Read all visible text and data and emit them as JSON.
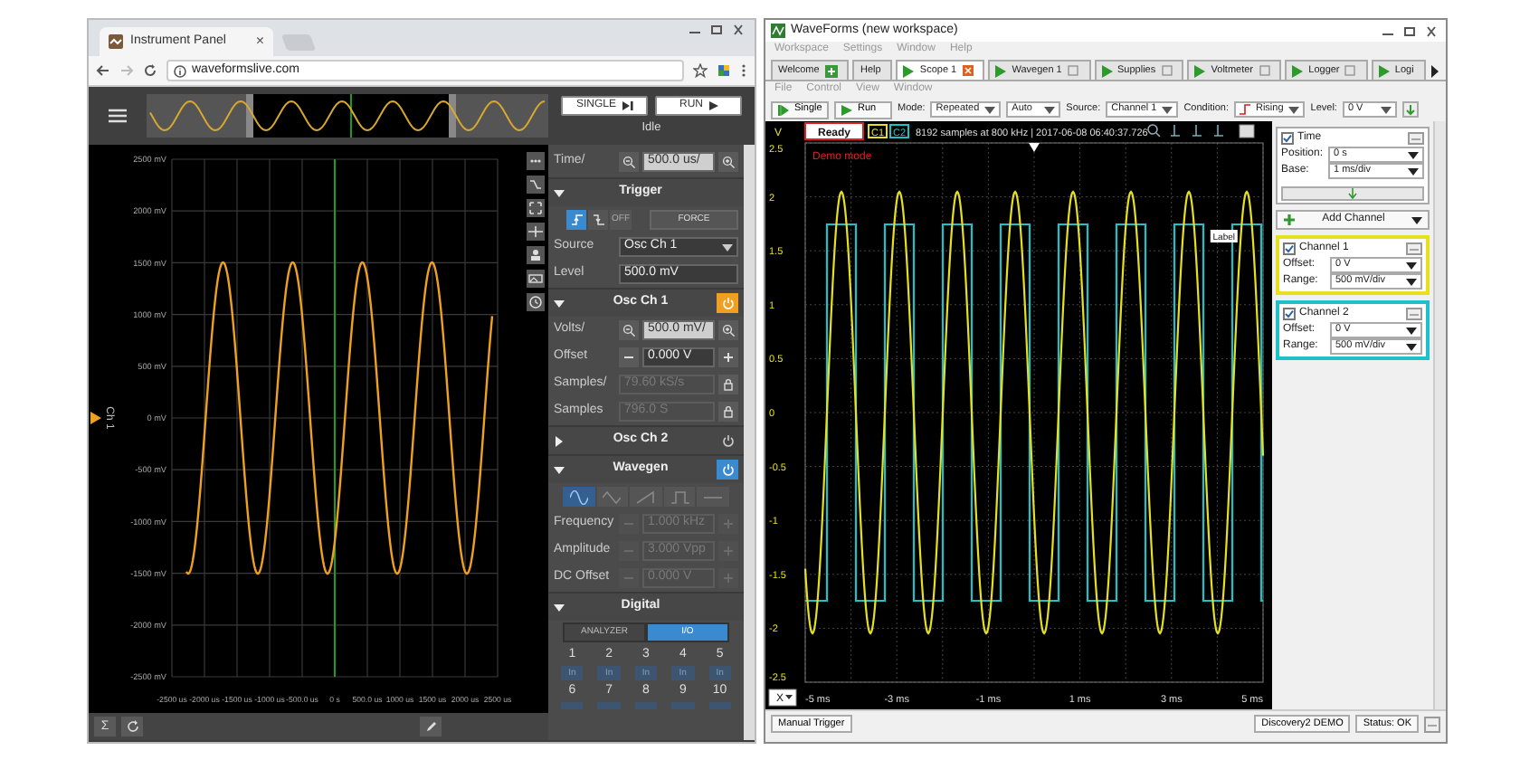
{
  "left_window": {
    "tab": {
      "title": "Instrument Panel",
      "close": "×"
    },
    "address": "waveformslive.com",
    "run_buttons": [
      {
        "label": "SINGLE",
        "kind": "single"
      },
      {
        "label": "RUN",
        "kind": "run"
      }
    ],
    "run_status": "Idle",
    "plot": {
      "channel_label": "Ch 1",
      "y_labels": [
        "2500 mV",
        "2000 mV",
        "1500 mV",
        "1000 mV",
        "500 mV",
        "0 mV",
        "-500 mV",
        "-1000 mV",
        "-1500 mV",
        "-2000 mV",
        "-2500 mV"
      ],
      "x_labels": [
        "-2500 us",
        "-2000 us",
        "-1500 us",
        "-1000 us",
        "-500.0 us",
        "0 s",
        "500.0 us",
        "1000 us",
        "1500 us",
        "2000 us",
        "2500 us"
      ]
    },
    "bottom_tools": [
      {
        "kind": "sigma",
        "glyph": "Σ"
      },
      {
        "kind": "refresh"
      },
      {
        "kind": "pencil"
      }
    ],
    "panel": {
      "time": {
        "label": "Time/",
        "value": "500.0 us/"
      },
      "sections": [
        {
          "kind": "trigger",
          "title": "Trigger",
          "expanded": true,
          "edges": [
            {
              "kind": "rising",
              "selected": true
            },
            {
              "kind": "falling",
              "selected": false
            },
            {
              "kind": "off",
              "label": "OFF",
              "selected": false
            }
          ],
          "force": "FORCE",
          "rows": [
            {
              "kind": "select",
              "label": "Source",
              "value": "Osc Ch 1",
              "disabled": false
            },
            {
              "kind": "input",
              "label": "Level",
              "value": "500.0 mV",
              "disabled": false
            }
          ]
        },
        {
          "kind": "osc",
          "title": "Osc Ch 1",
          "expanded": true,
          "on": true,
          "color": "#f0a020",
          "rows": [
            {
              "kind": "zoom",
              "label": "Volts/",
              "value": "500.0 mV/",
              "disabled": false
            },
            {
              "kind": "stepper",
              "label": "Offset",
              "value": "0.000 V",
              "disabled": false
            },
            {
              "kind": "locked",
              "label": "Samples/",
              "value": "79.60 kS/s",
              "disabled": true
            },
            {
              "kind": "locked",
              "label": "Samples",
              "value": "796.0 S",
              "disabled": true
            }
          ]
        },
        {
          "kind": "osc",
          "title": "Osc Ch 2",
          "expanded": false,
          "on": false
        },
        {
          "kind": "wavegen",
          "title": "Wavegen",
          "expanded": true,
          "on": true,
          "color": "#3a8ad0",
          "shapes": [
            {
              "kind": "sine",
              "selected": true
            },
            {
              "kind": "triangle",
              "selected": false
            },
            {
              "kind": "sawtooth",
              "selected": false
            },
            {
              "kind": "square",
              "selected": false
            },
            {
              "kind": "dc",
              "selected": false
            }
          ],
          "rows": [
            {
              "kind": "stepper",
              "label": "Frequency",
              "value": "1.000 kHz",
              "disabled": true
            },
            {
              "kind": "stepper",
              "label": "Amplitude",
              "value": "3.000 Vpp",
              "disabled": true
            },
            {
              "kind": "stepper",
              "label": "DC Offset",
              "value": "0.000 V",
              "disabled": true
            }
          ]
        },
        {
          "kind": "digital",
          "title": "Digital",
          "expanded": true,
          "modes": [
            {
              "label": "ANALYZER",
              "selected": false
            },
            {
              "label": "I/O",
              "selected": true
            }
          ],
          "pins": [
            {
              "number": "1",
              "state": "In"
            },
            {
              "number": "2",
              "state": "In"
            },
            {
              "number": "3",
              "state": "In"
            },
            {
              "number": "4",
              "state": "In"
            },
            {
              "number": "5",
              "state": "In"
            },
            {
              "number": "6"
            },
            {
              "number": "7"
            },
            {
              "number": "8"
            },
            {
              "number": "9"
            },
            {
              "number": "10"
            }
          ]
        }
      ]
    }
  },
  "right_window": {
    "title": "WaveForms (new workspace)",
    "menu": [
      "Workspace",
      "Settings",
      "Window",
      "Help"
    ],
    "tabs": [
      {
        "kind": "welcome",
        "label": "Welcome",
        "selected": false
      },
      {
        "kind": "plain",
        "label": "Help",
        "selected": false
      },
      {
        "kind": "instrument",
        "label": "Scope 1",
        "selected": true
      },
      {
        "kind": "instrument",
        "label": "Wavegen 1",
        "selected": false
      },
      {
        "kind": "instrument",
        "label": "Supplies",
        "selected": false
      },
      {
        "kind": "instrument",
        "label": "Voltmeter",
        "selected": false
      },
      {
        "kind": "instrument",
        "label": "Logger",
        "selected": false
      },
      {
        "kind": "cut",
        "label": "Logi",
        "selected": false
      }
    ],
    "submenu": [
      "File",
      "Control",
      "View",
      "Window"
    ],
    "toolbar": {
      "buttons": [
        {
          "kind": "single",
          "label": "Single"
        },
        {
          "kind": "run",
          "label": "Run"
        }
      ],
      "fields": [
        {
          "label": "Mode:",
          "selects": [
            {
              "value": "Repeated"
            },
            {
              "value": "Auto"
            }
          ]
        },
        {
          "label": "Source:",
          "selects": [
            {
              "value": "Channel 1"
            }
          ]
        },
        {
          "label": "Condition:",
          "selects": [
            {
              "value": "Rising",
              "kind": "edge"
            }
          ]
        },
        {
          "label": "Level:",
          "selects": [
            {
              "value": "0 V"
            }
          ]
        }
      ]
    },
    "plot": {
      "unit": "V",
      "status": "Ready",
      "channel_tags": [
        {
          "label": "C1",
          "color": "#e6e020"
        },
        {
          "label": "C2",
          "color": "#20c0c8"
        }
      ],
      "info": "8192 samples at 800 kHz | 2017-06-08 06:40:37.726",
      "mode_note": "Demo mode",
      "trace_label": "Label",
      "x_axis_select": "X",
      "y_labels": [
        "2.5",
        "2",
        "1.5",
        "1",
        "0.5",
        "0",
        "-0.5",
        "-1",
        "-1.5",
        "-2",
        "-2.5"
      ],
      "x_labels": [
        "-5 ms",
        "-3 ms",
        "-1 ms",
        "1 ms",
        "3 ms",
        "5 ms"
      ]
    },
    "side": {
      "time": {
        "label": "Time",
        "checked": true,
        "rows": [
          {
            "label": "Position:",
            "value": "0 s"
          },
          {
            "label": "Base:",
            "value": "1 ms/div"
          }
        ]
      },
      "add_channel": "Add Channel",
      "channels": [
        {
          "name": "Channel 1",
          "checked": true,
          "color": "#e6e020",
          "rows": [
            {
              "label": "Offset:",
              "value": "0 V"
            },
            {
              "label": "Range:",
              "value": "500 mV/div"
            }
          ]
        },
        {
          "name": "Channel 2",
          "checked": true,
          "color": "#20c0c8",
          "rows": [
            {
              "label": "Offset:",
              "value": "0 V"
            },
            {
              "label": "Range:",
              "value": "500 mV/div"
            }
          ]
        }
      ]
    },
    "status_bar": {
      "left": [
        "Manual Trigger"
      ],
      "right": [
        "Discovery2 DEMO",
        "Status: OK"
      ]
    }
  }
}
